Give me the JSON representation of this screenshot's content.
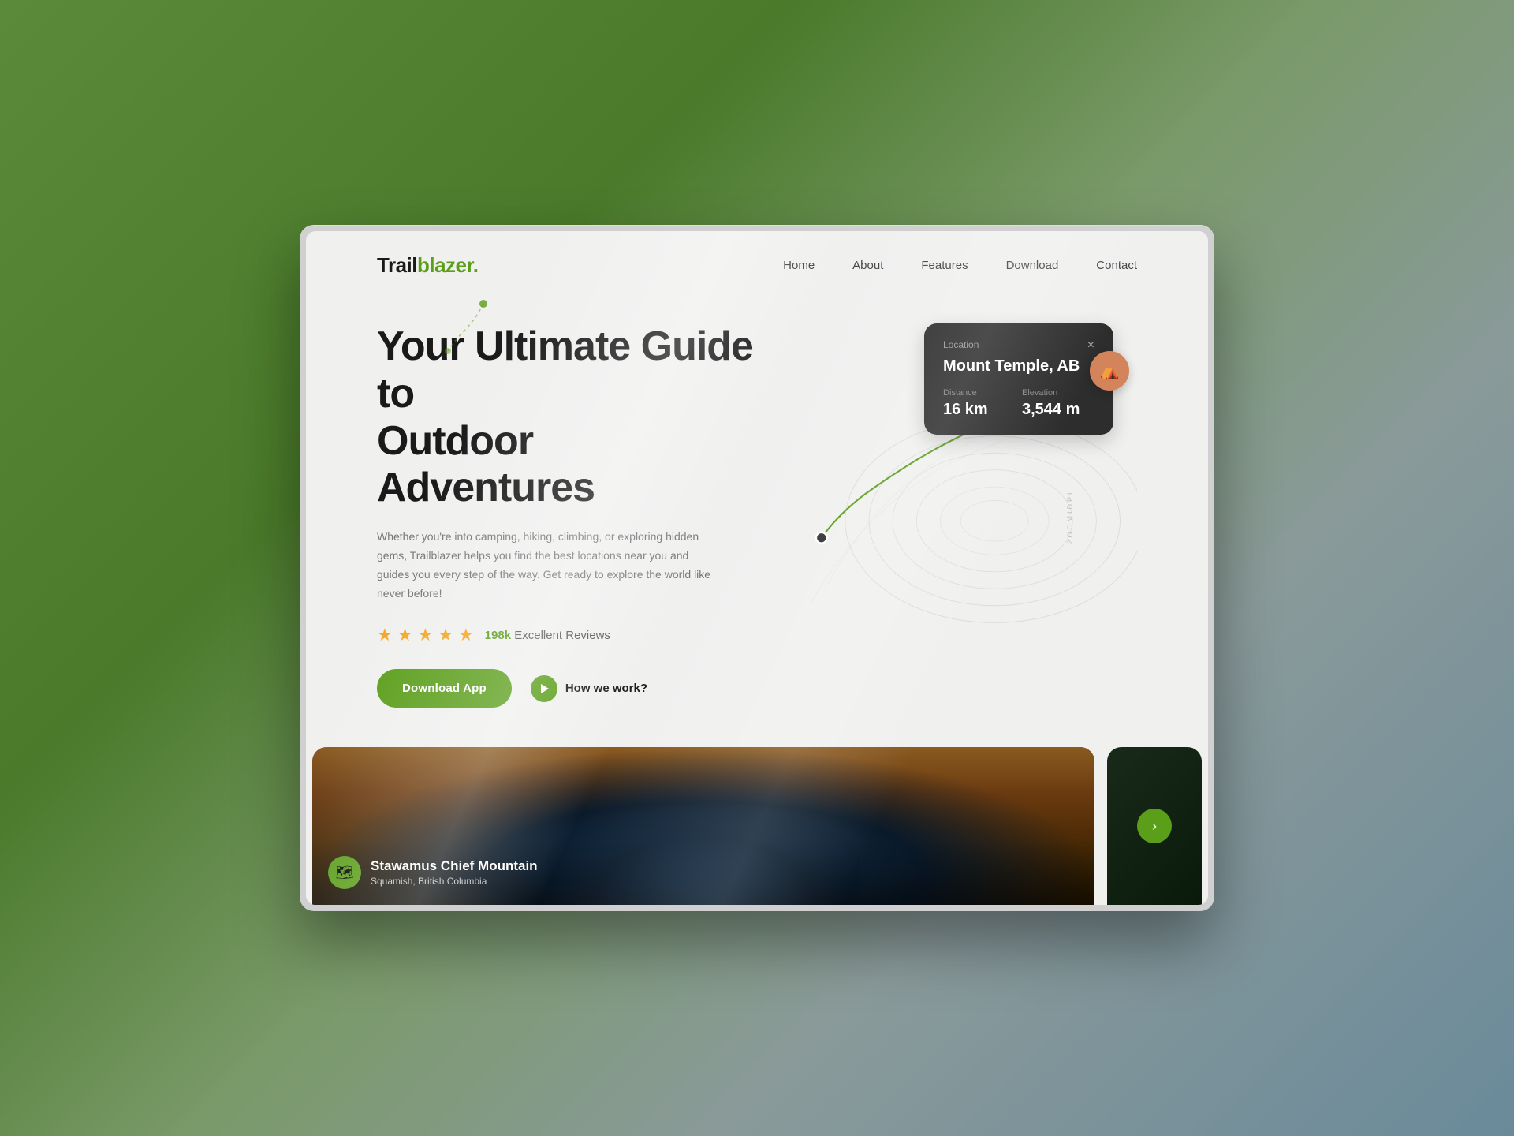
{
  "logo": {
    "trail": "Trail",
    "blazer": "blazer",
    "dot": "."
  },
  "nav": {
    "items": [
      {
        "label": "Home",
        "href": "#"
      },
      {
        "label": "About",
        "href": "#"
      },
      {
        "label": "Features",
        "href": "#"
      },
      {
        "label": "Download",
        "href": "#"
      },
      {
        "label": "Contact",
        "href": "#"
      }
    ]
  },
  "hero": {
    "title_line1": "Your Ultimate Guide to",
    "title_line2": "Outdoor Adventures",
    "description": "Whether you're into camping, hiking, climbing, or exploring hidden gems, Trailblazer helps you find the best locations near you and guides you every step of the way. Get ready to explore the world like never before!",
    "reviews_count": "198k",
    "reviews_text": "Excellent Reviews",
    "stars_count": 5,
    "download_btn": "Download App",
    "how_we_work": "How we work?"
  },
  "location_card": {
    "label": "Location",
    "name": "Mount Temple, AB",
    "distance_label": "Distance",
    "distance_value": "16 km",
    "elevation_label": "Elevation",
    "elevation_value": "3,544 m",
    "close_icon": "×"
  },
  "bottom_card": {
    "name": "Stawamus Chief Mountain",
    "location": "Squamish, British Columbia",
    "icon": "🗺"
  },
  "topo_labels": {
    "label1": "MIDPL",
    "label2": "2OOMIDPL"
  },
  "colors": {
    "green": "#5a9e1a",
    "dark": "#2d2d2d",
    "orange_pin": "#d4845a"
  }
}
